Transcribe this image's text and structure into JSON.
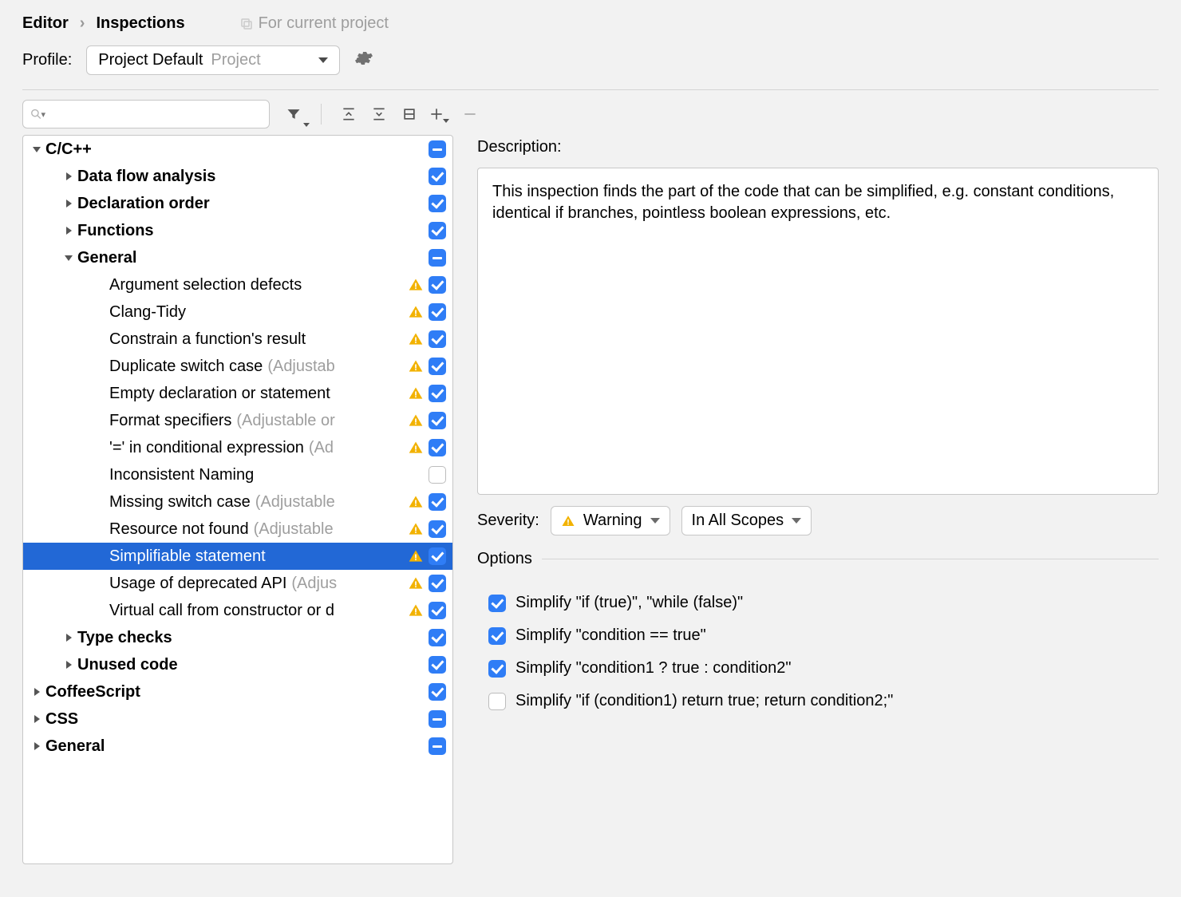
{
  "breadcrumb": {
    "part1": "Editor",
    "sep": "›",
    "part2": "Inspections",
    "hint": "For current project"
  },
  "profile": {
    "label": "Profile:",
    "name": "Project Default",
    "scope": "Project"
  },
  "search": {
    "placeholder": ""
  },
  "tree": [
    {
      "indent": 0,
      "label": "C/C++",
      "bold": true,
      "arrow": "ex",
      "cb": "mix",
      "warn": false
    },
    {
      "indent": 1,
      "label": "Data flow analysis",
      "bold": true,
      "arrow": "col",
      "cb": "on",
      "warn": false
    },
    {
      "indent": 1,
      "label": "Declaration order",
      "bold": true,
      "arrow": "col",
      "cb": "on",
      "warn": false
    },
    {
      "indent": 1,
      "label": "Functions",
      "bold": true,
      "arrow": "col",
      "cb": "on",
      "warn": false
    },
    {
      "indent": 1,
      "label": "General",
      "bold": true,
      "arrow": "ex",
      "cb": "mix",
      "warn": false
    },
    {
      "indent": 2,
      "label": "Argument selection defects",
      "cb": "on",
      "warn": true
    },
    {
      "indent": 2,
      "label": "Clang-Tidy",
      "cb": "on",
      "warn": true
    },
    {
      "indent": 2,
      "label": "Constrain a function's result",
      "cb": "on",
      "warn": true
    },
    {
      "indent": 2,
      "label": "Duplicate switch case",
      "suffix": "(Adjustab",
      "cb": "on",
      "warn": true
    },
    {
      "indent": 2,
      "label": "Empty declaration or statement",
      "cb": "on",
      "warn": true
    },
    {
      "indent": 2,
      "label": "Format specifiers",
      "suffix": "(Adjustable or",
      "cb": "on",
      "warn": true
    },
    {
      "indent": 2,
      "label": "'=' in conditional expression",
      "suffix": "(Ad",
      "cb": "on",
      "warn": true
    },
    {
      "indent": 2,
      "label": "Inconsistent Naming",
      "cb": "off",
      "warn": false
    },
    {
      "indent": 2,
      "label": "Missing switch case",
      "suffix": "(Adjustable",
      "cb": "on",
      "warn": true
    },
    {
      "indent": 2,
      "label": "Resource not found",
      "suffix": "(Adjustable",
      "cb": "on",
      "warn": true
    },
    {
      "indent": 2,
      "label": "Simplifiable statement",
      "cb": "on",
      "warn": true,
      "selected": true
    },
    {
      "indent": 2,
      "label": "Usage of deprecated API",
      "suffix": "(Adjus",
      "cb": "on",
      "warn": true
    },
    {
      "indent": 2,
      "label": "Virtual call from constructor or d",
      "cb": "on",
      "warn": true
    },
    {
      "indent": 1,
      "label": "Type checks",
      "bold": true,
      "arrow": "col",
      "cb": "on",
      "warn": false
    },
    {
      "indent": 1,
      "label": "Unused code",
      "bold": true,
      "arrow": "col",
      "cb": "on",
      "warn": false
    },
    {
      "indent": 0,
      "label": "CoffeeScript",
      "bold": true,
      "arrow": "col",
      "cb": "on",
      "warn": false
    },
    {
      "indent": 0,
      "label": "CSS",
      "bold": true,
      "arrow": "col",
      "cb": "mix",
      "warn": false
    },
    {
      "indent": 0,
      "label": "General",
      "bold": true,
      "arrow": "col",
      "cb": "mix",
      "warn": false
    }
  ],
  "detail": {
    "desc_label": "Description:",
    "desc_text": "This inspection finds the part of the code that can be simplified, e.g. constant conditions, identical if branches, pointless boolean expressions, etc.",
    "severity_label": "Severity:",
    "severity_value": "Warning",
    "scope_value": "In All Scopes",
    "options_label": "Options",
    "options": [
      {
        "checked": true,
        "text": "Simplify \"if (true)\", \"while (false)\""
      },
      {
        "checked": true,
        "text": "Simplify \"condition == true\""
      },
      {
        "checked": true,
        "text": "Simplify \"condition1 ? true : condition2\""
      },
      {
        "checked": false,
        "text": "Simplify \"if (condition1) return true; return condition2;\""
      }
    ]
  }
}
